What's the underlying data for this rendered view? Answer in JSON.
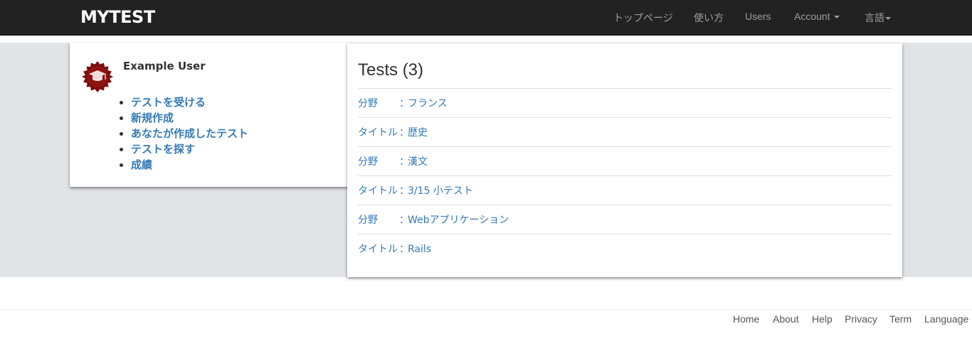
{
  "navbar": {
    "brand": "MYTEST",
    "items": [
      {
        "label": "トップページ"
      },
      {
        "label": "使い方"
      },
      {
        "label": "Users"
      },
      {
        "label": "Account"
      },
      {
        "label": "言語"
      }
    ]
  },
  "user": {
    "name": "Example User",
    "avatar_icon": "graduation-cap-icon",
    "avatar_color": "#7b0d0d",
    "menu": [
      {
        "label": "テストを受ける"
      },
      {
        "label": "新規作成"
      },
      {
        "label": "あなたが作成したテスト"
      },
      {
        "label": "テストを探す"
      },
      {
        "label": "成績"
      }
    ]
  },
  "tests": {
    "title": "Tests (3)",
    "rows": [
      {
        "label": "分野",
        "sep": "：",
        "value": "フランス"
      },
      {
        "label": "タイトル",
        "sep": "：",
        "value": "歴史"
      },
      {
        "label": "分野",
        "sep": "：",
        "value": "漢文"
      },
      {
        "label": "タイトル",
        "sep": "：",
        "value": "3/15 小テスト"
      },
      {
        "label": "分野",
        "sep": "：",
        "value": "Webアプリケーション"
      },
      {
        "label": "タイトル",
        "sep": "：",
        "value": "Rails"
      }
    ]
  },
  "footer": {
    "links": [
      {
        "label": "Home"
      },
      {
        "label": "About"
      },
      {
        "label": "Help"
      },
      {
        "label": "Privacy"
      },
      {
        "label": "Term"
      },
      {
        "label": "Language"
      }
    ]
  },
  "colors": {
    "navbar_bg": "#222222",
    "link": "#337ab7",
    "band_bg": "#e1e4e7"
  }
}
